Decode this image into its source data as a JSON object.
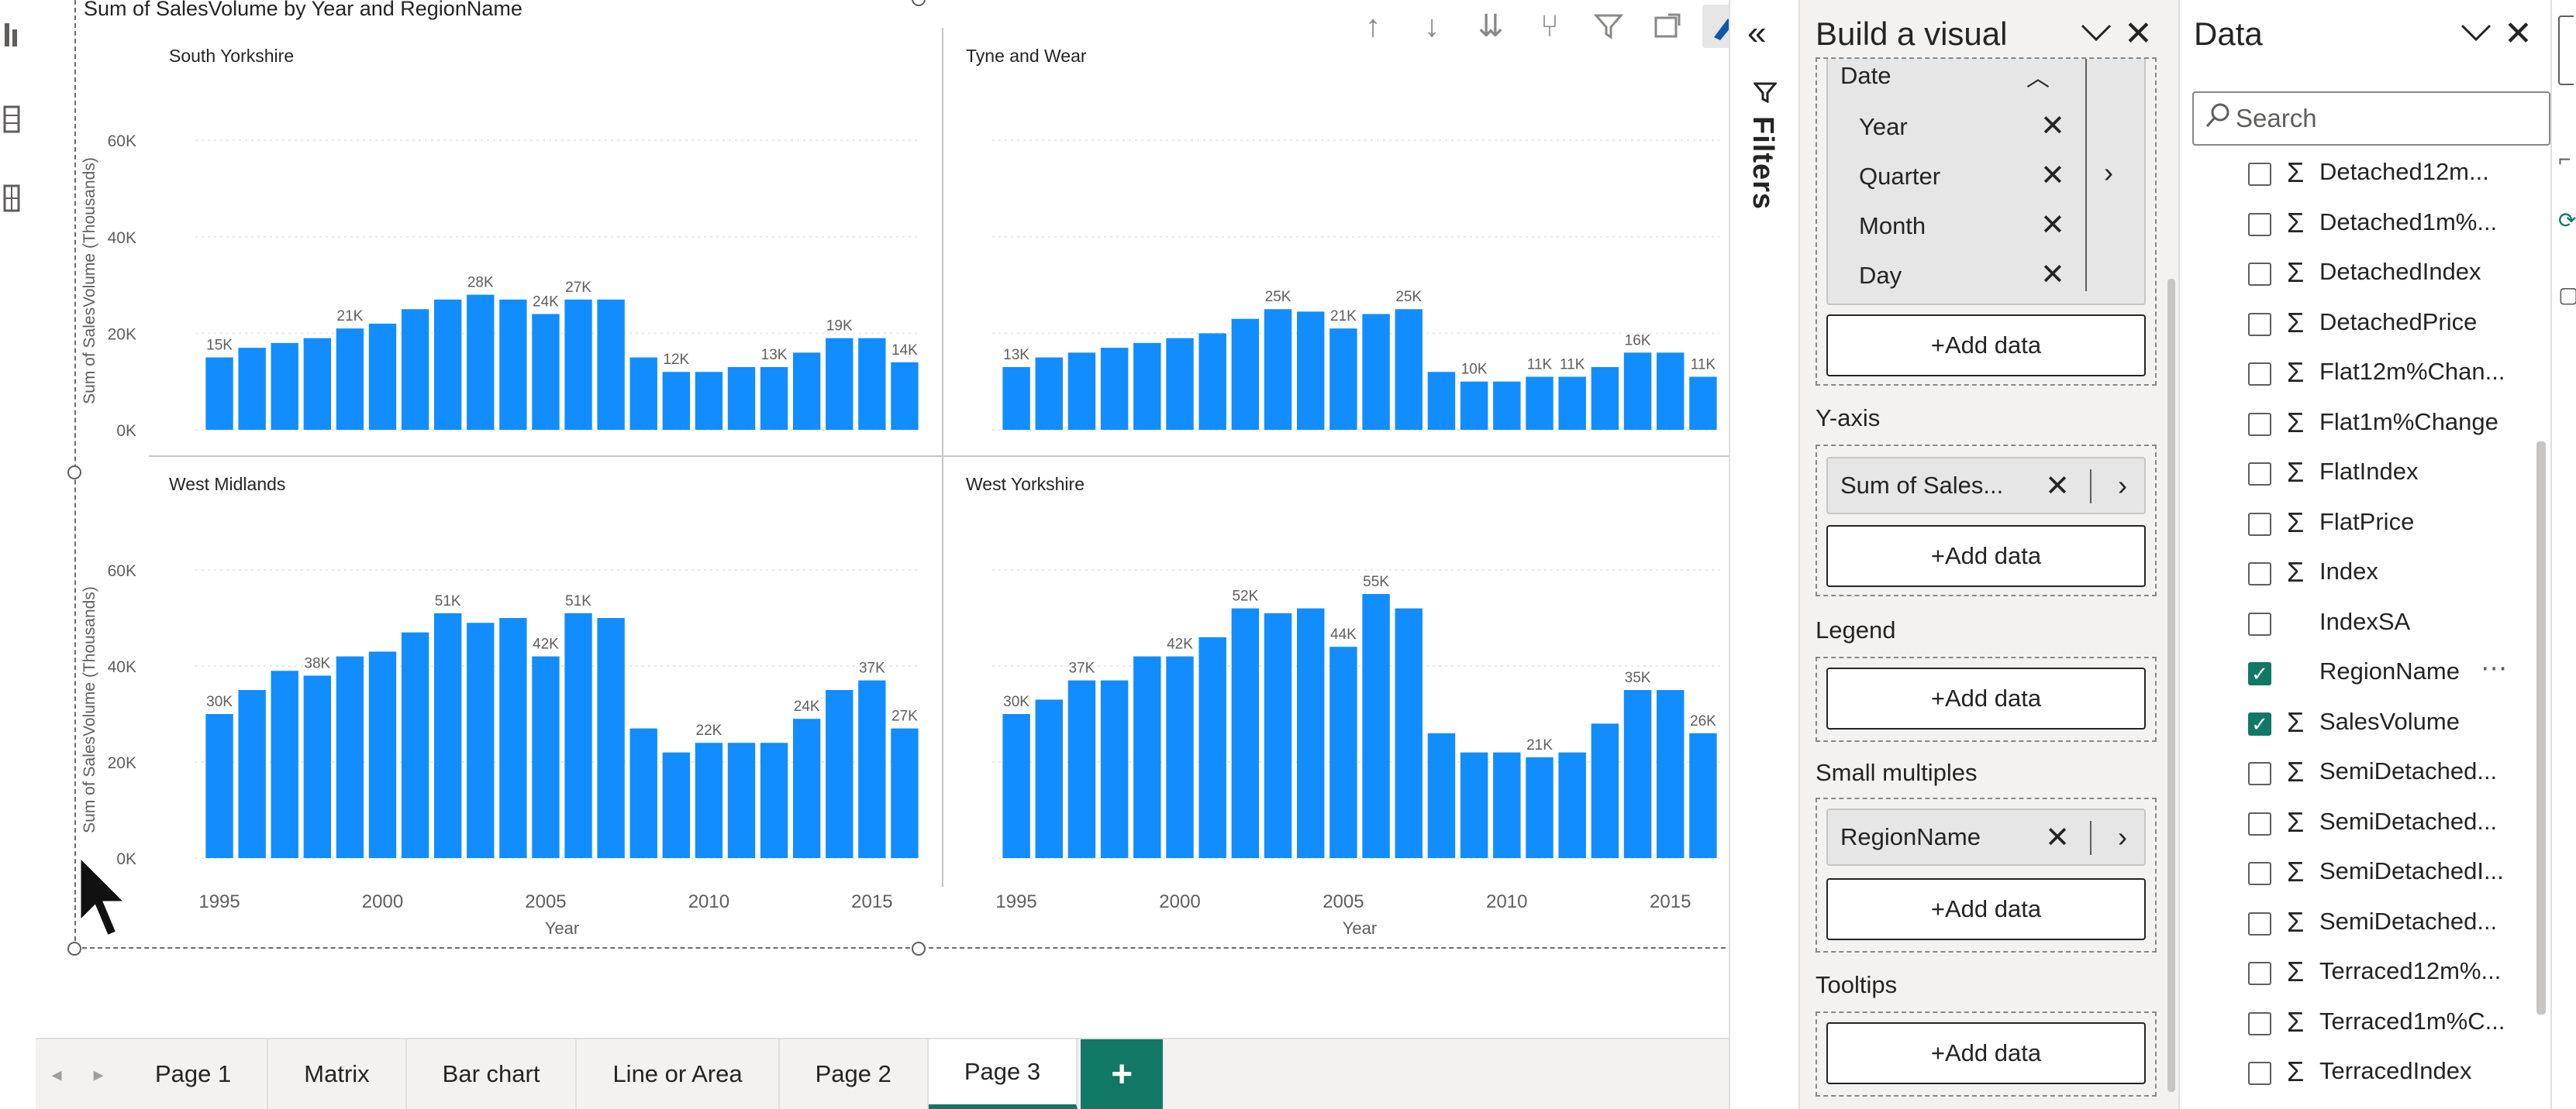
{
  "visual": {
    "title": "Sum of SalesVolume by Year and RegionName"
  },
  "chart_data": {
    "type": "bar",
    "small_multiples": true,
    "x": [
      1995,
      1996,
      1997,
      1998,
      1999,
      2000,
      2001,
      2002,
      2003,
      2004,
      2005,
      2006,
      2007,
      2008,
      2009,
      2010,
      2011,
      2012,
      2013,
      2014,
      2015,
      2016
    ],
    "xticks": [
      "1995",
      "2000",
      "2005",
      "2010",
      "2015"
    ],
    "xlabel": "Year",
    "ylabel": "Sum of SalesVolume (Thousands)",
    "yticks": [
      "0K",
      "20K",
      "40K",
      "60K"
    ],
    "ylim": [
      0,
      65
    ],
    "bar_color": "#118DFF",
    "panels": [
      {
        "name": "South Yorkshire",
        "values": [
          15,
          17,
          18,
          19,
          21,
          22,
          25,
          27,
          28,
          27,
          24,
          27,
          27,
          15,
          12,
          12,
          13,
          13,
          16,
          19,
          19,
          14
        ],
        "labels": {
          "0": "15K",
          "4": "21K",
          "8": "28K",
          "10": "24K",
          "11": "27K",
          "14": "12K",
          "17": "13K",
          "19": "19K",
          "21": "14K"
        }
      },
      {
        "name": "Tyne and Wear",
        "values": [
          13,
          15,
          16,
          17,
          18,
          19,
          20,
          23,
          25,
          24.5,
          21,
          24,
          25,
          12,
          10,
          10,
          11,
          11,
          13,
          16,
          16,
          11
        ],
        "labels": {
          "0": "13K",
          "8": "25K",
          "10": "21K",
          "12": "25K",
          "14": "10K",
          "16": "11K",
          "17": "11K",
          "19": "16K",
          "21": "11K"
        }
      },
      {
        "name": "West Midlands",
        "values": [
          30,
          35,
          39,
          38,
          42,
          43,
          47,
          51,
          49,
          50,
          42,
          51,
          50,
          27,
          22,
          24,
          24,
          24,
          29,
          35,
          37,
          27
        ],
        "labels": {
          "0": "30K",
          "3": "38K",
          "7": "51K",
          "10": "42K",
          "11": "51K",
          "15": "22K",
          "18": "24K",
          "20": "37K",
          "21": "27K"
        }
      },
      {
        "name": "West Yorkshire",
        "values": [
          30,
          33,
          37,
          37,
          42,
          42,
          46,
          52,
          51,
          52,
          44,
          55,
          52,
          26,
          22,
          22,
          21,
          22,
          28,
          35,
          35,
          26
        ],
        "labels": {
          "0": "30K",
          "2": "37K",
          "5": "42K",
          "7": "52K",
          "10": "44K",
          "11": "55K",
          "16": "21K",
          "19": "35K",
          "21": "26K"
        }
      }
    ]
  },
  "filters": {
    "label": "Filters"
  },
  "build": {
    "title": "Build a visual",
    "hierarchy_top": "Date",
    "hierarchy": [
      "Year",
      "Quarter",
      "Month",
      "Day"
    ],
    "add_data": "+Add data",
    "wells": {
      "yaxis": {
        "label": "Y-axis",
        "field": "Sum of Sales..."
      },
      "legend": {
        "label": "Legend"
      },
      "small_multiples": {
        "label": "Small multiples",
        "field": "RegionName"
      },
      "tooltips": {
        "label": "Tooltips"
      }
    }
  },
  "data": {
    "title": "Data",
    "search_placeholder": "Search",
    "fields": [
      {
        "label": "Detached12m...",
        "sigma": true,
        "checked": false
      },
      {
        "label": "Detached1m%...",
        "sigma": true,
        "checked": false
      },
      {
        "label": "DetachedIndex",
        "sigma": true,
        "checked": false
      },
      {
        "label": "DetachedPrice",
        "sigma": true,
        "checked": false
      },
      {
        "label": "Flat12m%Chan...",
        "sigma": true,
        "checked": false
      },
      {
        "label": "Flat1m%Change",
        "sigma": true,
        "checked": false
      },
      {
        "label": "FlatIndex",
        "sigma": true,
        "checked": false
      },
      {
        "label": "FlatPrice",
        "sigma": true,
        "checked": false
      },
      {
        "label": "Index",
        "sigma": true,
        "checked": false
      },
      {
        "label": "IndexSA",
        "sigma": false,
        "checked": false
      },
      {
        "label": "RegionName",
        "sigma": false,
        "checked": true,
        "more": true
      },
      {
        "label": "SalesVolume",
        "sigma": true,
        "checked": true
      },
      {
        "label": "SemiDetached...",
        "sigma": true,
        "checked": false
      },
      {
        "label": "SemiDetached...",
        "sigma": true,
        "checked": false
      },
      {
        "label": "SemiDetachedI...",
        "sigma": true,
        "checked": false
      },
      {
        "label": "SemiDetached...",
        "sigma": true,
        "checked": false
      },
      {
        "label": "Terraced12m%...",
        "sigma": true,
        "checked": false
      },
      {
        "label": "Terraced1m%C...",
        "sigma": true,
        "checked": false
      },
      {
        "label": "TerracedIndex",
        "sigma": true,
        "checked": false
      }
    ]
  },
  "pages": {
    "tabs": [
      "Page 1",
      "Matrix",
      "Bar chart",
      "Line or Area",
      "Page 2",
      "Page 3"
    ],
    "active": "Page 3",
    "add": "+"
  }
}
